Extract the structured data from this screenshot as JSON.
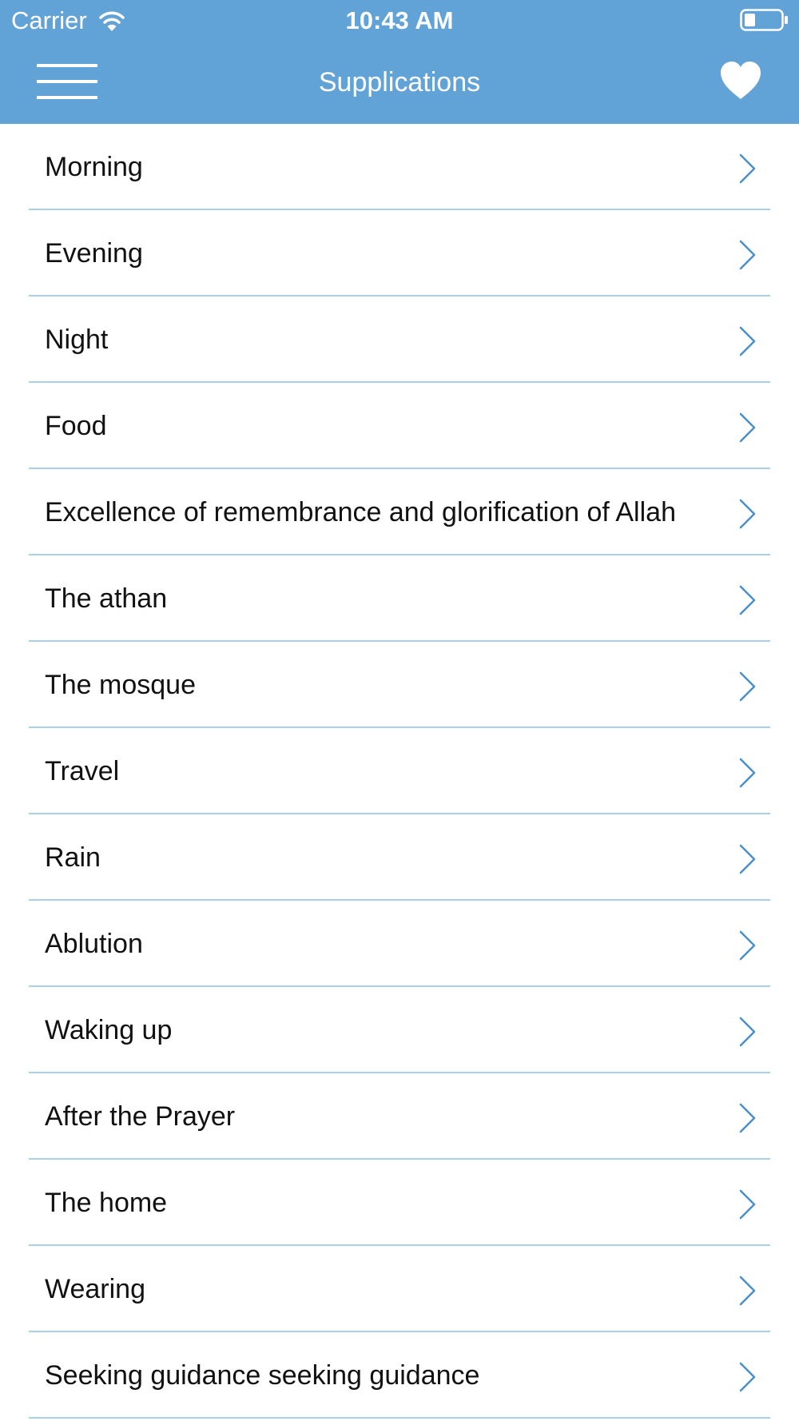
{
  "status_bar": {
    "carrier": "Carrier",
    "time": "10:43 AM",
    "wifi_icon": "wifi-icon",
    "battery_icon": "battery-icon"
  },
  "nav_bar": {
    "title": "Supplications",
    "menu_icon": "hamburger-menu-icon",
    "favorites_icon": "heart-icon",
    "background_color": "#62a3d7"
  },
  "list": {
    "chevron_icon": "chevron-right-icon",
    "chevron_color": "#4a90c8",
    "separator_color": "#a9d0ea",
    "items": [
      {
        "label": "Morning"
      },
      {
        "label": "Evening"
      },
      {
        "label": "Night"
      },
      {
        "label": "Food"
      },
      {
        "label": "Excellence of remembrance and glorification of Allah"
      },
      {
        "label": "The athan"
      },
      {
        "label": "The mosque"
      },
      {
        "label": "Travel"
      },
      {
        "label": "Rain"
      },
      {
        "label": "Ablution"
      },
      {
        "label": "Waking up"
      },
      {
        "label": "After the Prayer"
      },
      {
        "label": "The home"
      },
      {
        "label": "Wearing"
      },
      {
        "label": "Seeking guidance seeking guidance"
      }
    ]
  }
}
